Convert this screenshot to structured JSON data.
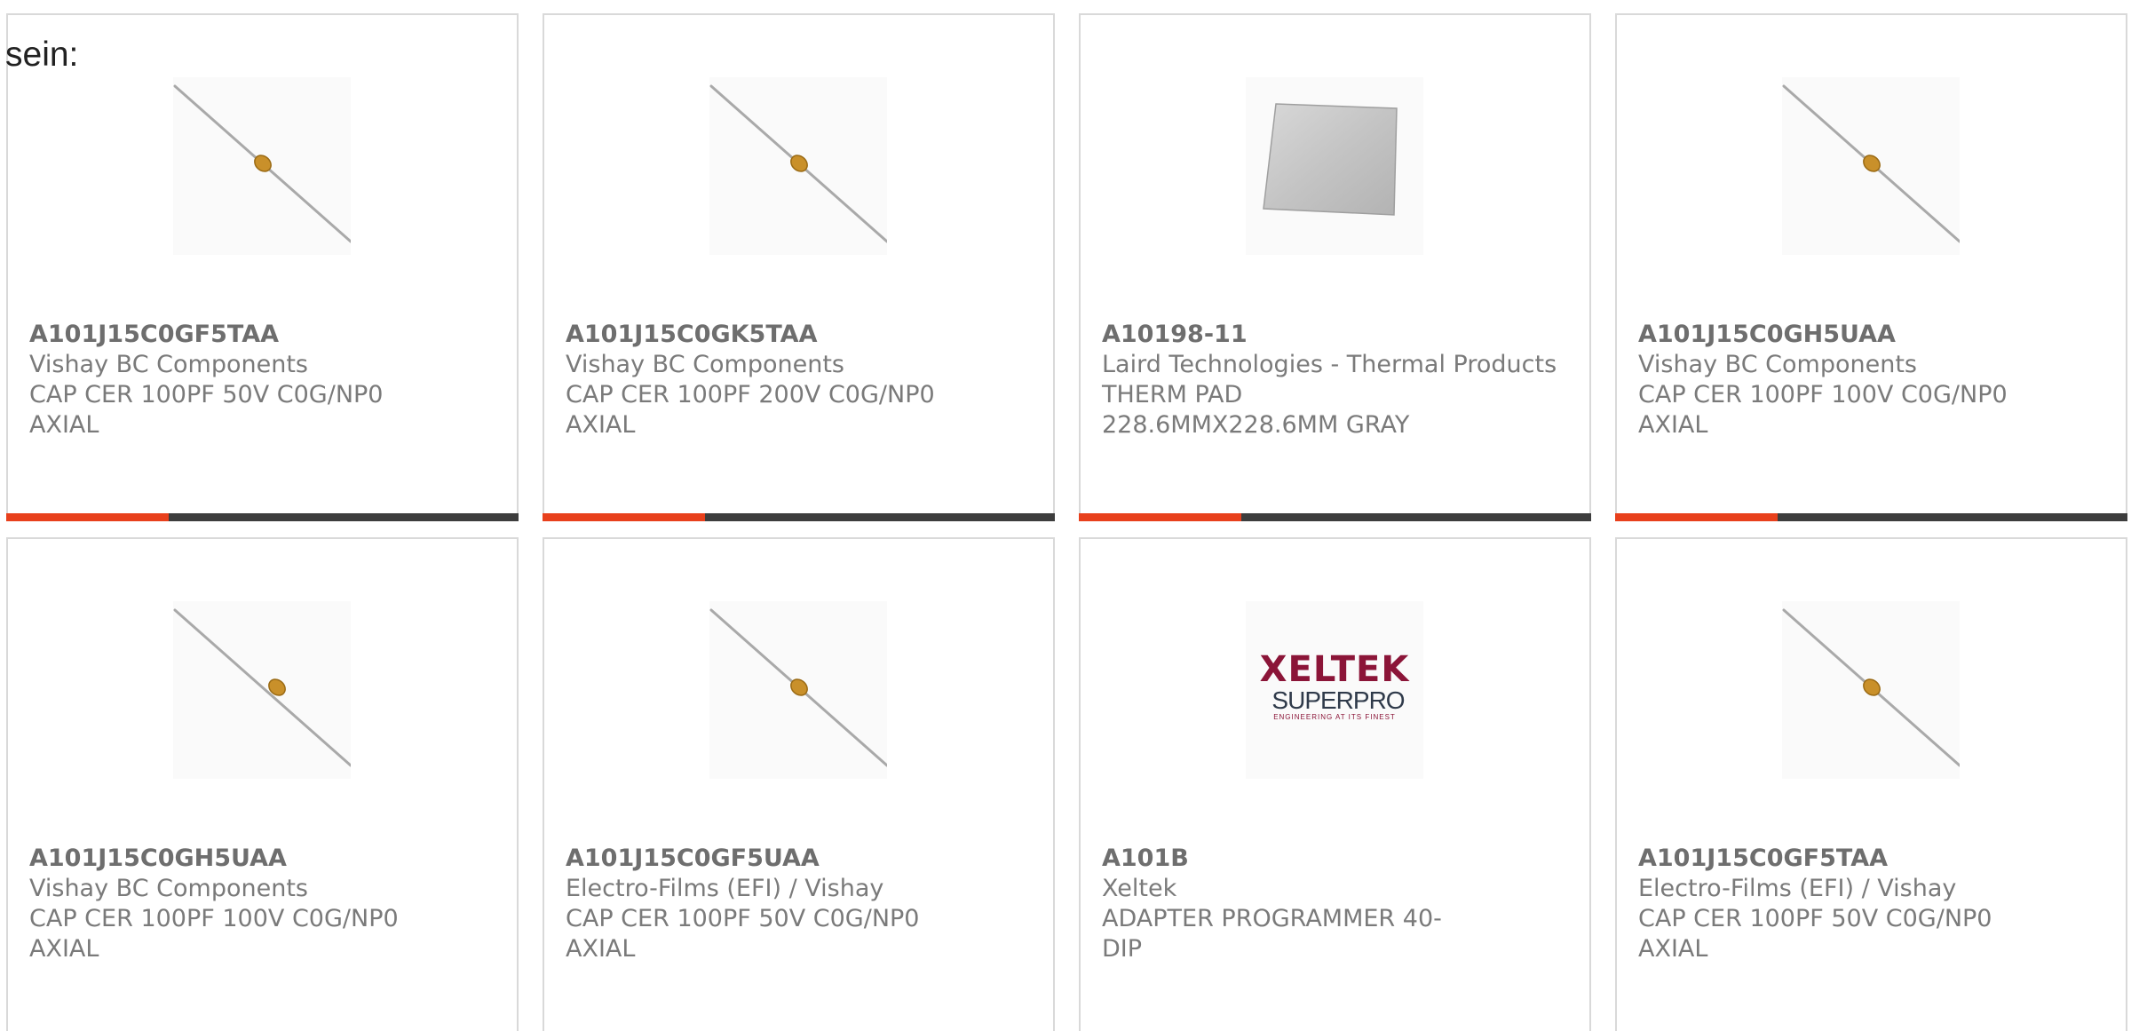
{
  "intro_text": "sein:",
  "colors": {
    "accent": "#e8401c",
    "bar": "#3d3d3d",
    "border": "#d9d9d9",
    "xeltek": "#8b1538",
    "superpro": "#2f3a4a"
  },
  "products": [
    {
      "part": "A101J15C0GF5TAA",
      "manufacturer": "Vishay BC Components",
      "description": "CAP CER 100PF 50V C0G/NP0 AXIAL",
      "image": "axial-capacitor-icon"
    },
    {
      "part": "A101J15C0GK5TAA",
      "manufacturer": "Vishay BC Components",
      "description": "CAP CER 100PF 200V C0G/NP0 AXIAL",
      "image": "axial-capacitor-icon"
    },
    {
      "part": "A10198-11",
      "manufacturer": "Laird Technologies - Thermal Products",
      "description": "THERM PAD 228.6MMX228.6MM GRAY",
      "image": "thermal-pad-icon"
    },
    {
      "part": "A101J15C0GH5UAA",
      "manufacturer": "Vishay BC Components",
      "description": "CAP CER 100PF 100V C0G/NP0 AXIAL",
      "image": "axial-capacitor-icon"
    },
    {
      "part": "A101J15C0GH5UAA",
      "manufacturer": "Vishay BC Components",
      "description": "CAP CER 100PF 100V C0G/NP0 AXIAL",
      "image": "axial-capacitor-icon"
    },
    {
      "part": "A101J15C0GF5UAA",
      "manufacturer": "Electro-Films (EFI) / Vishay",
      "description": "CAP CER 100PF 50V C0G/NP0 AXIAL",
      "image": "axial-capacitor-icon"
    },
    {
      "part": "A101B",
      "manufacturer": "Xeltek",
      "description": "ADAPTER PROGRAMMER 40-DIP",
      "image": "xeltek-logo",
      "logo": {
        "line1": "XELTEK",
        "line2": "SUPERPRO",
        "tagline": "ENGINEERING AT ITS FINEST"
      }
    },
    {
      "part": "A101J15C0GF5TAA",
      "manufacturer": "Electro-Films (EFI) / Vishay",
      "description": "CAP CER 100PF 50V C0G/NP0 AXIAL",
      "image": "axial-capacitor-icon"
    }
  ]
}
